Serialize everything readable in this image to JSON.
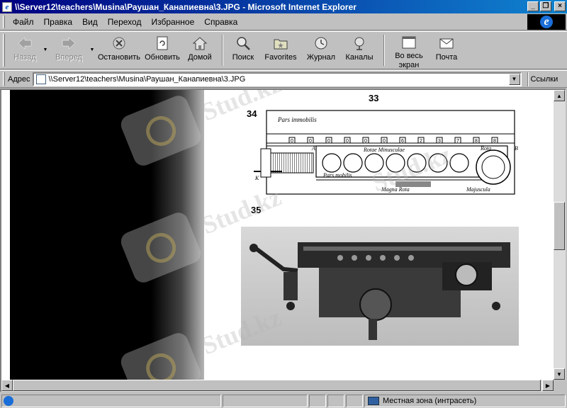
{
  "window": {
    "title": "\\\\Server12\\teachers\\Musina\\Раушан_Канапиевна\\3.JPG - Microsoft Internet Explorer",
    "minimize": "_",
    "maximize": "❐",
    "close": "×"
  },
  "menu": [
    "Файл",
    "Правка",
    "Вид",
    "Переход",
    "Избранное",
    "Справка"
  ],
  "toolbar": {
    "back": "Назад",
    "forward": "Вперед",
    "stop": "Остановить",
    "refresh": "Обновить",
    "home": "Домой",
    "search": "Поиск",
    "favorites": "Favorites",
    "history": "Журнал",
    "channels": "Каналы",
    "fullscreen_line1": "Во весь",
    "fullscreen_line2": "экран",
    "mail": "Почта"
  },
  "address": {
    "label": "Адрес",
    "value": "\\\\Server12\\teachers\\Musina\\Раушан_Канапиевна\\3.JPG",
    "links": "Ссылки"
  },
  "document": {
    "fig33": "33",
    "fig34": "34",
    "fig35": "35",
    "diagram": {
      "pars_immobilis": "Pars immobilis",
      "rotae_minusculae": "Rotae Minusculae",
      "pars_mobilis": "Pars mobilis",
      "magna_rota": "Magna Rota",
      "rota": "Rota",
      "majuscula": "Majuscula",
      "label_a": "A",
      "label_b": "B",
      "label_k": "K",
      "digits": [
        "0",
        "0",
        "0",
        "0",
        "0",
        "0",
        "6",
        "2",
        "3",
        "7",
        "8",
        "8"
      ]
    },
    "watermark": "Stud.kz"
  },
  "status": {
    "zone": "Местная зона (интрасеть)"
  }
}
